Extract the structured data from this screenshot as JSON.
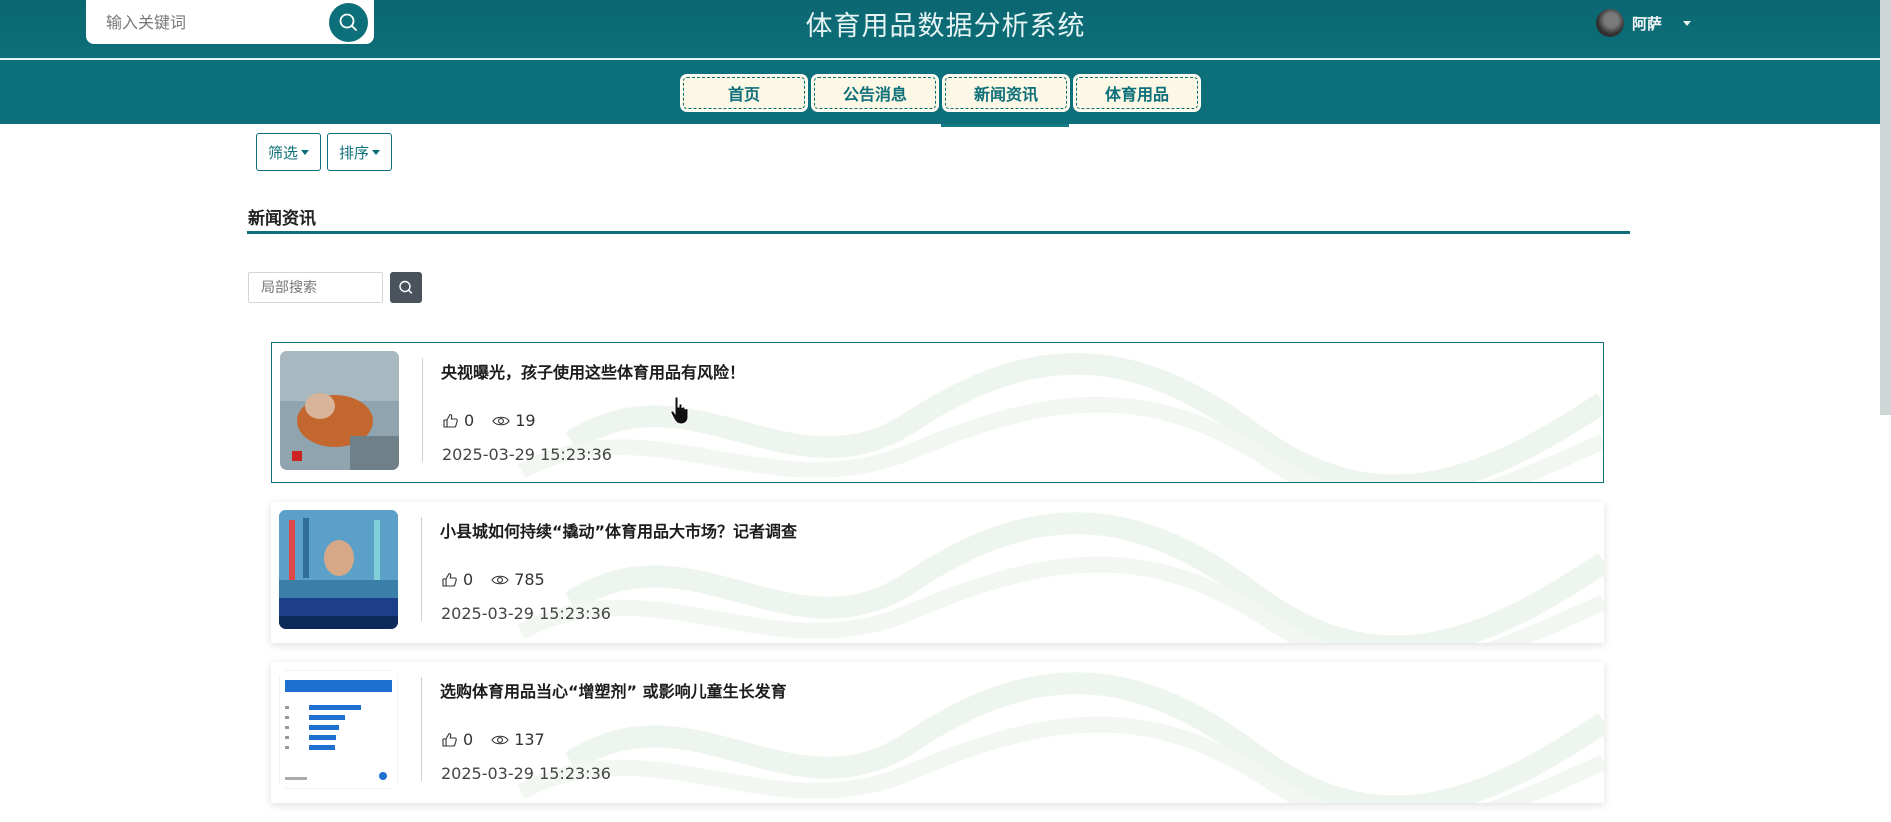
{
  "header": {
    "search_placeholder": "输入关键词",
    "site_title": "体育用品数据分析系统",
    "username": "阿萨"
  },
  "nav": {
    "tabs": [
      {
        "label": "首页"
      },
      {
        "label": "公告消息"
      },
      {
        "label": "新闻资讯"
      },
      {
        "label": "体育用品"
      }
    ],
    "active": "新闻资讯"
  },
  "filters": {
    "filter_label": "筛选",
    "sort_label": "排序"
  },
  "section": {
    "title": "新闻资讯",
    "local_search_placeholder": "局部搜索"
  },
  "news": [
    {
      "title": "央视曝光，孩子使用这些体育用品有风险！",
      "likes": "0",
      "views": "19",
      "date": "2025-03-29 15:23:36"
    },
    {
      "title": "小县城如何持续“撬动”体育用品大市场？记者调查",
      "likes": "0",
      "views": "785",
      "date": "2025-03-29 15:23:36"
    },
    {
      "title": "选购体育用品当心“增塑剂” 或影响儿童生长发育",
      "likes": "0",
      "views": "137",
      "date": "2025-03-29 15:23:36"
    }
  ],
  "colors": {
    "primary": "#0d6f79",
    "tab_background": "#fdf8e6"
  }
}
